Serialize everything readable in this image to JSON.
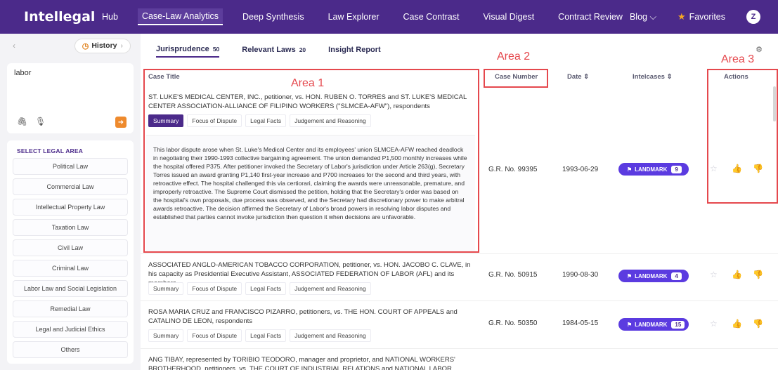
{
  "app": {
    "logo": "Intellegal"
  },
  "nav": {
    "items": [
      "Hub",
      "Case-Law Analytics",
      "Deep Synthesis",
      "Law Explorer",
      "Case Contrast",
      "Visual Digest",
      "Contract Review"
    ],
    "blog": "Blog ⌵",
    "favorites": "Favorites",
    "avatar": "Z"
  },
  "sidebar": {
    "history": "History",
    "query": "labor",
    "legal_heading": "SELECT LEGAL AREA",
    "legal_areas": [
      "Political Law",
      "Commercial Law",
      "Intellectual Property Law",
      "Taxation Law",
      "Civil Law",
      "Criminal Law",
      "Labor Law and Social Legislation",
      "Remedial Law",
      "Legal and Judicial Ethics",
      "Others"
    ]
  },
  "tabs": [
    {
      "label": "Jurisprudence",
      "count": "50"
    },
    {
      "label": "Relevant Laws",
      "count": "20"
    },
    {
      "label": "Insight Report",
      "count": ""
    }
  ],
  "annotations": {
    "area1": "Area 1",
    "area2": "Area 2",
    "area3": "Area 3"
  },
  "table": {
    "headers": {
      "title": "Case Title",
      "number": "Case Number",
      "date": "Date ⇕",
      "intel": "Intelcases ⇕",
      "actions": "Actions"
    },
    "chips": [
      "Summary",
      "Focus of Dispute",
      "Legal Facts",
      "Judgement and Reasoning"
    ],
    "badge_label": "LANDMARK",
    "rows": [
      {
        "title": "ST. LUKE'S MEDICAL CENTER, INC., petitioner, vs. HON. RUBEN O. TORRES and ST. LUKE'S MEDICAL CENTER ASSOCIATION-ALLIANCE OF FILIPINO WORKERS (\"SLMCEA-AFW\"), respondents",
        "summary": "This labor dispute arose when St. Luke's Medical Center and its employees' union SLMCEA-AFW reached deadlock in negotiating their 1990-1993 collective bargaining agreement. The union demanded P1,500 monthly increases while the hospital offered P375. After petitioner invoked the Secretary of Labor's jurisdiction under Article 263(g), Secretary Torres issued an award granting P1,140 first-year increase and P700 increases for the second and third years, with retroactive effect. The hospital challenged this via certiorari, claiming the awards were unreasonable, premature, and improperly retroactive. The Supreme Court dismissed the petition, holding that the Secretary's order was based on the hospital's own proposals, due process was observed, and the Secretary had discretionary power to make arbitral awards retroactive. The decision affirmed the Secretary of Labor's broad powers in resolving labor disputes and established that parties cannot invoke jurisdiction then question it when decisions are unfavorable.",
        "number": "G.R. No. 99395",
        "date": "1993-06-29",
        "count": "9"
      },
      {
        "title": "ASSOCIATED ANGLO-AMERICAN TOBACCO CORPORATION, petitioner, vs. HON. JACOBO C. CLAVE, in his capacity as Presidential Executive Assistant, ASSOCIATED FEDERATION OF LABOR (AFL) and its members,...",
        "number": "G.R. No. 50915",
        "date": "1990-08-30",
        "count": "4"
      },
      {
        "title": "ROSA MARIA CRUZ and FRANCISCO PIZARRO, petitioners, vs. THE HON. COURT OF APPEALS and CATALINO DE LEON, respondents",
        "number": "G.R. No. 50350",
        "date": "1984-05-15",
        "count": "15"
      },
      {
        "title": "ANG TIBAY, represented by TORIBIO TEODORO, manager and proprietor, and NATIONAL WORKERS' BROTHERHOOD, petitioners, vs. THE COURT OF INDUSTRIAL RELATIONS and NATIONAL LABOR UNION,..."
      }
    ]
  },
  "colors": {
    "brand": "#4b2a8a",
    "badge": "#5b3be0",
    "annotation": "#e5484d",
    "accent": "#ee8a2d"
  }
}
